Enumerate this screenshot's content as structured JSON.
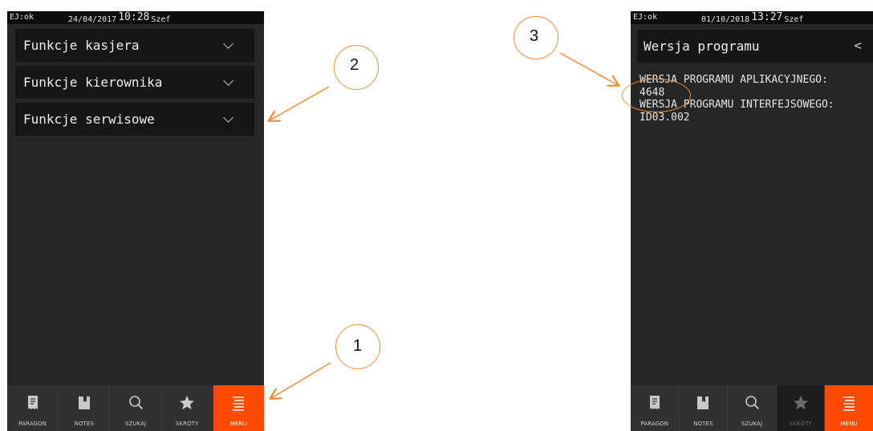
{
  "left_screen": {
    "status": {
      "ej": "EJ:ok",
      "date": "24/04/2017",
      "time": "10:28",
      "user": "Szef"
    },
    "menu_items": [
      {
        "label": "Funkcje kasjera"
      },
      {
        "label": "Funkcje kierownika"
      },
      {
        "label": "Funkcje serwisowe"
      }
    ],
    "nav": [
      {
        "label": "PARAGON",
        "icon": "receipt-icon"
      },
      {
        "label": "NOTES",
        "icon": "bookmark-icon"
      },
      {
        "label": "SZUKAJ",
        "icon": "search-icon"
      },
      {
        "label": "SKRÓTY",
        "icon": "star-icon"
      },
      {
        "label": "MENU",
        "icon": "menu-icon",
        "active": true
      }
    ]
  },
  "right_screen": {
    "status": {
      "ej": "EJ:ok",
      "date": "01/10/2018",
      "time": "13:27",
      "user": "Szef"
    },
    "header": {
      "title": "Wersja programu",
      "back": "<"
    },
    "info_lines": [
      "WERSJA PROGRAMU APLIKACYJNEGO:",
      "4648",
      "WERSJA PROGRAMU INTERFEJSOWEGO:",
      "ID03.002"
    ],
    "nav": [
      {
        "label": "PARAGON",
        "icon": "receipt-icon"
      },
      {
        "label": "NOTES",
        "icon": "bookmark-icon"
      },
      {
        "label": "SZUKAJ",
        "icon": "search-icon"
      },
      {
        "label": "SKRÓTY",
        "icon": "star-icon",
        "disabled": true
      },
      {
        "label": "MENU",
        "icon": "menu-icon",
        "active": true
      }
    ]
  },
  "callouts": [
    "1",
    "2",
    "3"
  ],
  "colors": {
    "accent": "#ff4a00",
    "annotation": "#ec8d3a",
    "screen_bg": "#262626"
  }
}
